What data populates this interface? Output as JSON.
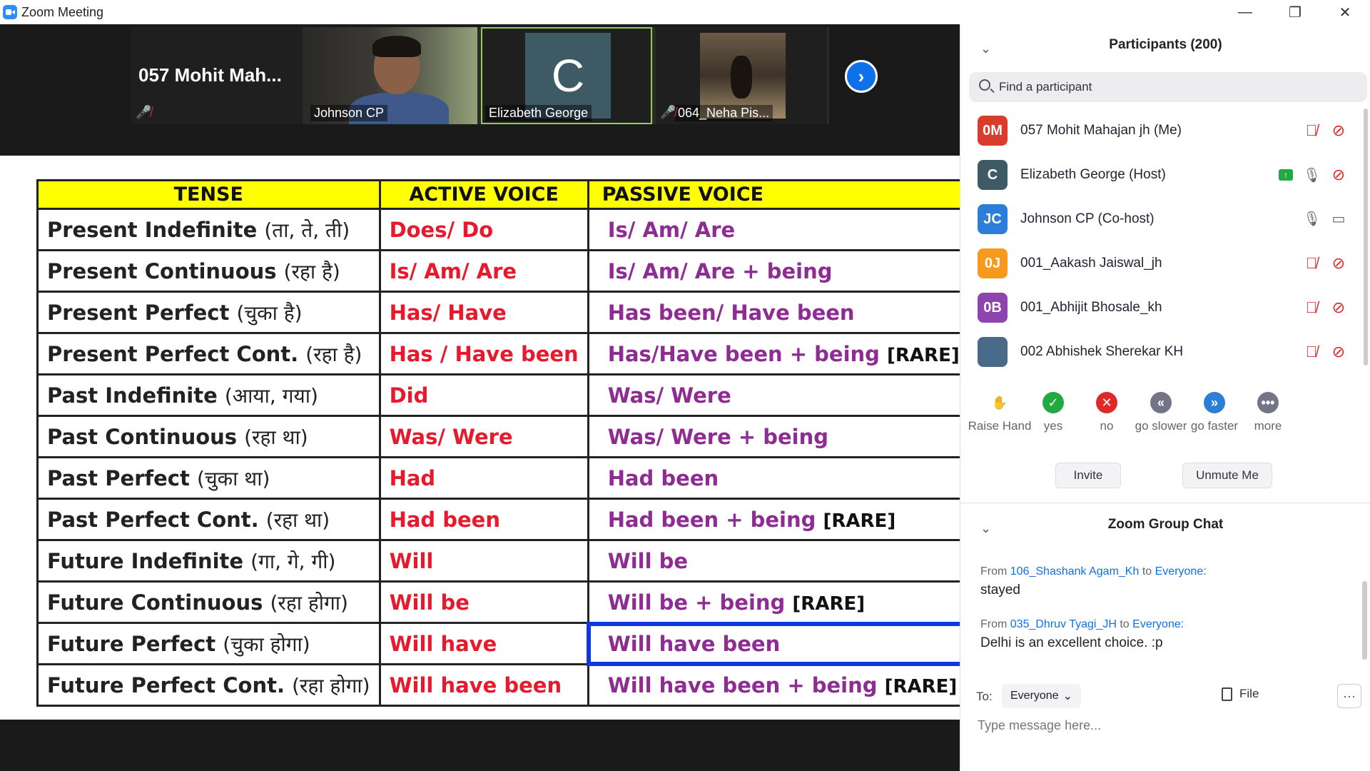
{
  "window": {
    "title": "Zoom Meeting",
    "minimize": "—",
    "restore": "❐",
    "close": "✕"
  },
  "videos": {
    "tiles": [
      {
        "name": "057 Mohit Mah..."
      },
      {
        "name": "Johnson CP"
      },
      {
        "name": "Elizabeth George",
        "avatar_letter": "C"
      },
      {
        "name": "064_Neha Pis..."
      }
    ],
    "next": "›"
  },
  "slide": {
    "headers": [
      "TENSE",
      "ACTIVE VOICE",
      "PASSIVE VOICE"
    ],
    "rows": [
      {
        "tense": "Present Indefinite",
        "hint": "(ता, ते, ती)",
        "active": "Does/ Do",
        "passive": "Is/ Am/ Are",
        "rare": ""
      },
      {
        "tense": "Present Continuous",
        "hint": "(रहा है)",
        "active": "Is/ Am/ Are",
        "passive": "Is/ Am/ Are + being",
        "rare": ""
      },
      {
        "tense": "Present Perfect",
        "hint": "(चुका है)",
        "active": "Has/ Have",
        "passive": "Has been/ Have been",
        "rare": ""
      },
      {
        "tense": "Present Perfect Cont.",
        "hint": "(रहा है)",
        "active": "Has / Have been",
        "passive": "Has/Have been + being",
        "rare": "[RARE]"
      },
      {
        "tense": "Past Indefinite",
        "hint": "(आया, गया)",
        "active": "Did",
        "passive": "Was/ Were",
        "rare": ""
      },
      {
        "tense": "Past Continuous",
        "hint": "(रहा था)",
        "active": "Was/ Were",
        "passive": "Was/ Were + being",
        "rare": ""
      },
      {
        "tense": "Past Perfect",
        "hint": "(चुका था)",
        "active": "Had",
        "passive": "Had been",
        "rare": ""
      },
      {
        "tense": "Past Perfect Cont.",
        "hint": "(रहा था)",
        "active": "Had been",
        "passive": "Had been + being",
        "rare": "[RARE]"
      },
      {
        "tense": "Future Indefinite",
        "hint": "(गा, गे, गी)",
        "active": "Will",
        "passive": "Will be",
        "rare": ""
      },
      {
        "tense": "Future Continuous",
        "hint": "(रहा होगा)",
        "active": "Will be",
        "passive": "Will be + being",
        "rare": "[RARE]"
      },
      {
        "tense": "Future Perfect",
        "hint": "(चुका होगा)",
        "active": "Will have",
        "passive": "Will have been",
        "rare": ""
      },
      {
        "tense": "Future Perfect Cont.",
        "hint": "(रहा होगा)",
        "active": "Will have been",
        "passive": "Will have been + being",
        "rare": "[RARE]"
      }
    ]
  },
  "participants": {
    "title": "Participants (200)",
    "search_placeholder": "Find a participant",
    "list": [
      {
        "initials": "0M",
        "name": "057 Mohit Mahajan jh (Me)",
        "color": "#d93b2c"
      },
      {
        "initials": "C",
        "name": "Elizabeth George (Host)",
        "color": "#3e5a65"
      },
      {
        "initials": "JC",
        "name": "Johnson CP (Co-host)",
        "color": "#2b7fd6"
      },
      {
        "initials": "0J",
        "name": "001_Aakash Jaiswal_jh",
        "color": "#f59a1c"
      },
      {
        "initials": "0B",
        "name": "001_Abhijit Bhosale_kh",
        "color": "#8e44ad"
      },
      {
        "initials": "",
        "name": "002 Abhishek Sherekar KH",
        "color": "#4a6a8a"
      }
    ],
    "reactions": [
      {
        "label": "Raise Hand",
        "symbol": "✋",
        "color": "#2b7fd6"
      },
      {
        "label": "yes",
        "symbol": "✓",
        "color": "#23a942"
      },
      {
        "label": "no",
        "symbol": "✕",
        "color": "#e02828"
      },
      {
        "label": "go slower",
        "symbol": "«",
        "color": "#747487"
      },
      {
        "label": "go faster",
        "symbol": "»",
        "color": "#2b7fd6"
      },
      {
        "label": "more",
        "symbol": "•••",
        "color": "#747487"
      }
    ],
    "invite": "Invite",
    "unmute": "Unmute Me"
  },
  "chat": {
    "title": "Zoom Group Chat",
    "messages": [
      {
        "from_prefix": "From",
        "from": "106_Shashank Agam_Kh",
        "to_word": "to",
        "to": "Everyone:",
        "text": "stayed"
      },
      {
        "from_prefix": "From",
        "from": "035_Dhruv Tyagi_JH",
        "to_word": "to",
        "to": "Everyone:",
        "text": "Delhi is an excellent choice. :p"
      }
    ],
    "to_label": "To:",
    "recipient": "Everyone",
    "file": "File",
    "more": "···",
    "input_placeholder": "Type message here..."
  }
}
